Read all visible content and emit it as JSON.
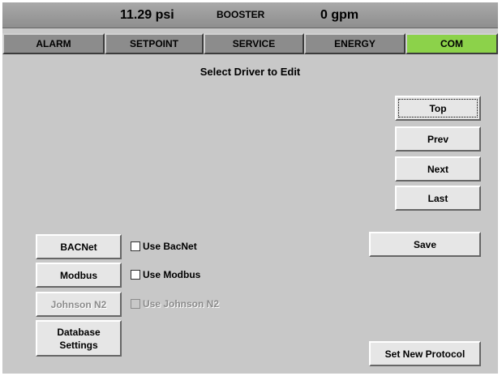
{
  "status": {
    "pressure": "11.29 psi",
    "mode": "BOOSTER",
    "flow": "0 gpm"
  },
  "tabs": [
    {
      "label": "ALARM",
      "active": false
    },
    {
      "label": "SETPOINT",
      "active": false
    },
    {
      "label": "SERVICE",
      "active": false
    },
    {
      "label": "ENERGY",
      "active": false
    },
    {
      "label": "COM",
      "active": true
    }
  ],
  "heading": "Select Driver to Edit",
  "nav": {
    "top": "Top",
    "prev": "Prev",
    "next": "Next",
    "last": "Last"
  },
  "save_label": "Save",
  "set_protocol_label": "Set New Protocol",
  "drivers": {
    "bacnet": {
      "button": "BACNet",
      "checkbox": "Use BacNet",
      "checked": false,
      "enabled": true
    },
    "modbus": {
      "button": "Modbus",
      "checkbox": "Use Modbus",
      "checked": false,
      "enabled": true
    },
    "johnson": {
      "button": "Johnson N2",
      "checkbox": "Use Johnson N2",
      "checked": false,
      "enabled": false
    },
    "database": {
      "button_line1": "Database",
      "button_line2": "Settings"
    }
  },
  "colors": {
    "active_tab": "#8cd24a",
    "tab": "#8c8c8c",
    "panel": "#c8c8c8",
    "status_bar": "#9c9c9c"
  }
}
